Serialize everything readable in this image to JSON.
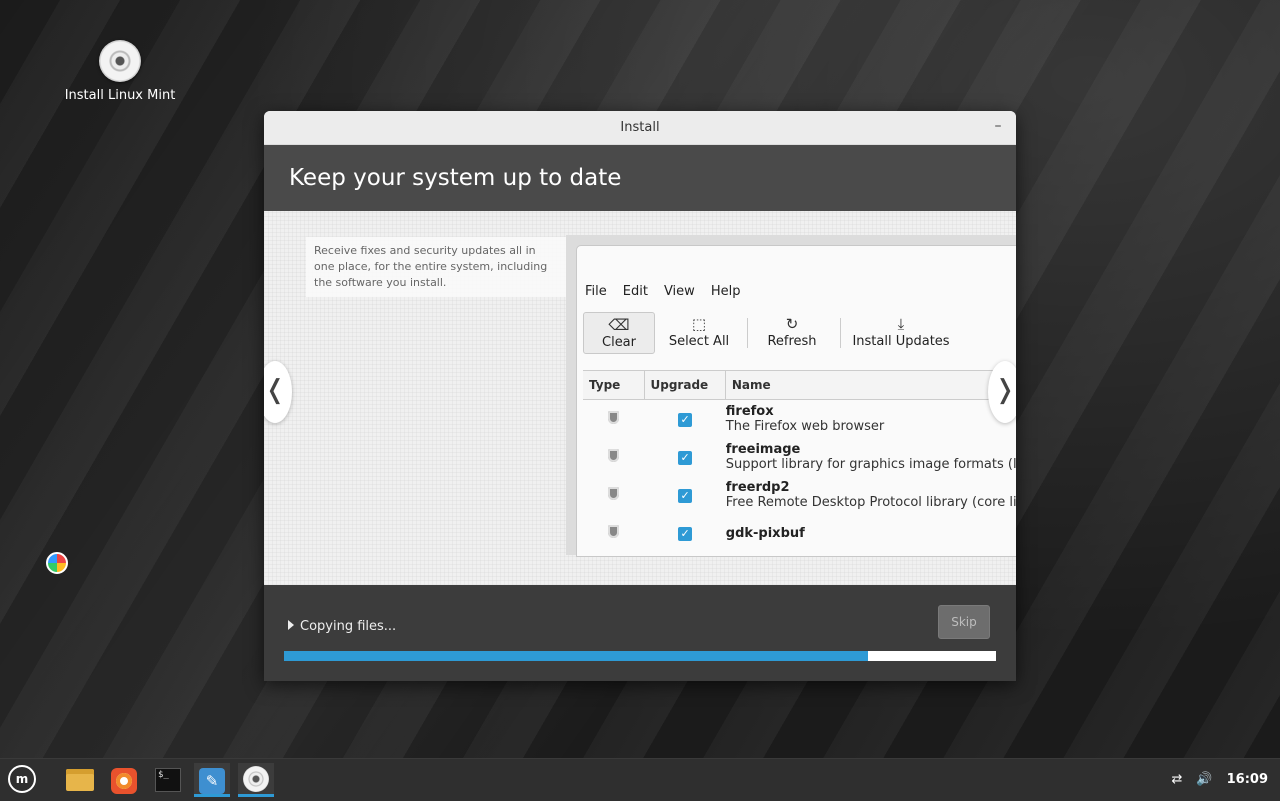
{
  "desktop": {
    "icon_label": "Install Linux Mint"
  },
  "window": {
    "title": "Install",
    "minimize_glyph": "–",
    "header": "Keep your system up to date",
    "description": "Receive fixes and security updates all in one place, for the entire system, including the software you install.",
    "nav_prev": "❬",
    "nav_next": "❭"
  },
  "update_manager": {
    "menu": [
      "File",
      "Edit",
      "View",
      "Help"
    ],
    "toolbar": [
      {
        "label": "Clear",
        "icon": "⌫"
      },
      {
        "label": "Select All",
        "icon": "⬚"
      },
      {
        "label": "Refresh",
        "icon": "↻"
      },
      {
        "label": "Install Updates",
        "icon": "⤓"
      }
    ],
    "columns": [
      "Type",
      "Upgrade",
      "Name"
    ],
    "packages": [
      {
        "name": "firefox",
        "desc": "The Firefox web browser"
      },
      {
        "name": "freeimage",
        "desc": "Support library for graphics image formats (libr"
      },
      {
        "name": "freerdp2",
        "desc": "Free Remote Desktop Protocol library (core libr"
      },
      {
        "name": "gdk-pixbuf",
        "desc": ""
      }
    ],
    "check_glyph": "✓"
  },
  "footer": {
    "status": "Copying files...",
    "skip_label": "Skip",
    "progress_fraction": 0.82
  },
  "taskbar": {
    "mint_label": "m",
    "terminal_glyph": "$_",
    "editor_glyph": "✎",
    "clock": "16:09",
    "network_glyph": "⇄",
    "volume_glyph": "🔊"
  },
  "colors": {
    "accent": "#2e9ad5",
    "header_bg": "#4a4a4a",
    "footer_bg": "#3c3c3c"
  }
}
